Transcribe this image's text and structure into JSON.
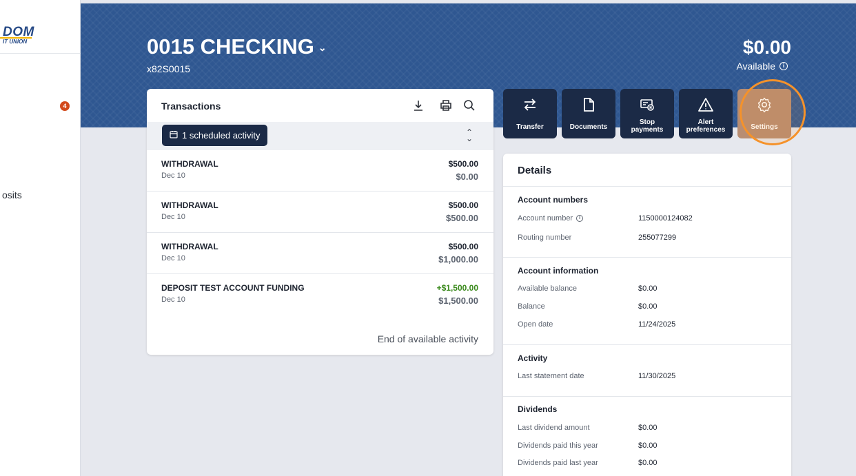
{
  "brand": {
    "logo_main": "DOM",
    "logo_sub": "IT UNION"
  },
  "sidebar": {
    "badge_count": "4",
    "partial_item": "osits"
  },
  "account": {
    "title": "0015 CHECKING",
    "number_label": "x82S0015",
    "balance": "$0.00",
    "balance_label": "Available",
    "info_glyph": "i"
  },
  "transactions": {
    "title": "Transactions",
    "scheduled_label": "1 scheduled activity",
    "end_text": "End of available activity",
    "rows": [
      {
        "description": "WITHDRAWAL",
        "date": "Dec 10",
        "amount": "$500.00",
        "balance": "$0.00",
        "positive": false
      },
      {
        "description": "WITHDRAWAL",
        "date": "Dec 10",
        "amount": "$500.00",
        "balance": "$500.00",
        "positive": false
      },
      {
        "description": "WITHDRAWAL",
        "date": "Dec 10",
        "amount": "$500.00",
        "balance": "$1,000.00",
        "positive": false
      },
      {
        "description": "DEPOSIT TEST ACCOUNT FUNDING",
        "date": "Dec 10",
        "amount": "+$1,500.00",
        "balance": "$1,500.00",
        "positive": true
      }
    ]
  },
  "actions": {
    "transfer": "Transfer",
    "documents": "Documents",
    "stop_payments_1": "Stop",
    "stop_payments_2": "payments",
    "alert_1": "Alert",
    "alert_2": "preferences",
    "settings": "Settings"
  },
  "details": {
    "title": "Details",
    "account_numbers": {
      "heading": "Account numbers",
      "account_number_label": "Account number",
      "account_number_value": "1150000124082",
      "routing_number_label": "Routing number",
      "routing_number_value": "255077299"
    },
    "account_information": {
      "heading": "Account information",
      "available_balance_label": "Available balance",
      "available_balance_value": "$0.00",
      "balance_label": "Balance",
      "balance_value": "$0.00",
      "open_date_label": "Open date",
      "open_date_value": "11/24/2025"
    },
    "activity": {
      "heading": "Activity",
      "last_statement_label": "Last statement date",
      "last_statement_value": "11/30/2025"
    },
    "dividends": {
      "heading": "Dividends",
      "last_amount_label": "Last dividend amount",
      "last_amount_value": "$0.00",
      "paid_this_year_label": "Dividends paid this year",
      "paid_this_year_value": "$0.00",
      "paid_last_year_label": "Dividends paid last year",
      "paid_last_year_value": "$0.00"
    }
  },
  "colors": {
    "banner": "#2f5791",
    "navy": "#1b2a46",
    "positive": "#3b8a1d",
    "highlight": "#f5922a",
    "badge": "#d24a1c"
  },
  "icons": [
    "download-icon",
    "print-icon",
    "search-icon",
    "calendar-icon",
    "sort-icon",
    "transfer-icon",
    "document-icon",
    "stop-payment-icon",
    "alert-icon",
    "gear-icon",
    "info-icon",
    "chevron-down-icon"
  ]
}
